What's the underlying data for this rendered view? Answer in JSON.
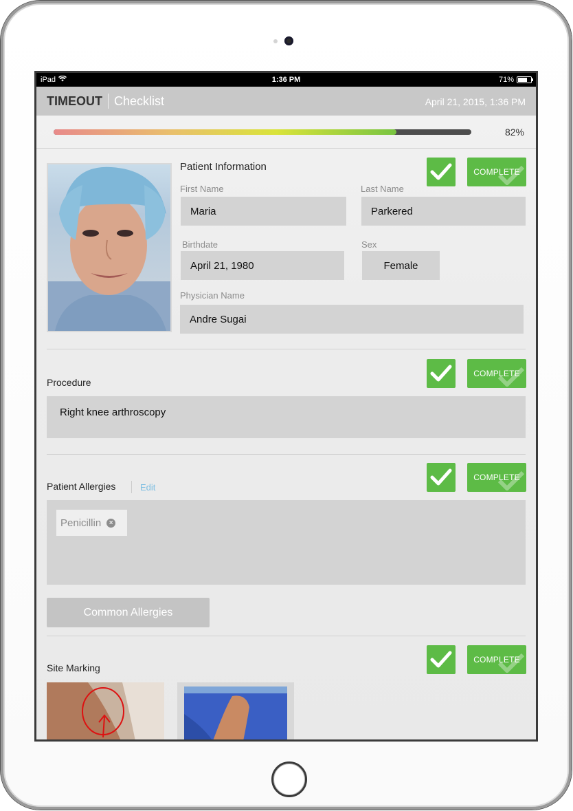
{
  "status_bar": {
    "carrier": "iPad",
    "time": "1:36 PM",
    "battery_percent": "71%",
    "battery_level": 0.71
  },
  "header": {
    "brand": "TIMEOUT",
    "subtitle": "Checklist",
    "datetime": "April 21, 2015, 1:36 PM"
  },
  "progress": {
    "percent_label": "82%",
    "fraction": 0.82
  },
  "patient_info": {
    "title": "Patient Information",
    "first_name_label": "First Name",
    "first_name": "Maria",
    "last_name_label": "Last Name",
    "last_name": "Parkered",
    "birthdate_label": "Birthdate",
    "birthdate": "April 21, 1980",
    "sex_label": "Sex",
    "sex": "Female",
    "physician_label": "Physician Name",
    "physician": "Andre Sugai",
    "complete_label": "COMPLETE"
  },
  "procedure": {
    "title": "Procedure",
    "value": "Right knee arthroscopy",
    "complete_label": "COMPLETE"
  },
  "allergies": {
    "title": "Patient Allergies",
    "edit_label": "Edit",
    "items": [
      "Penicillin"
    ],
    "common_button": "Common Allergies",
    "complete_label": "COMPLETE"
  },
  "site_marking": {
    "title": "Site Marking",
    "complete_label": "COMPLETE"
  },
  "colors": {
    "accent_green": "#5dbb46",
    "field_gray": "#d3d3d3",
    "link_blue": "#7bbde2"
  },
  "icons": {
    "check": "check-icon",
    "remove": "remove-chip-icon",
    "wifi": "wifi-icon",
    "battery": "battery-icon"
  }
}
